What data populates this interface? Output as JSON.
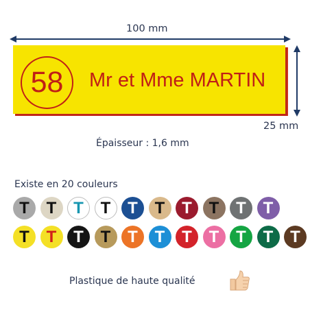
{
  "dimensions": {
    "width_label": "100 mm",
    "height_label": "25 mm",
    "thickness_label": "Épaisseur : 1,6 mm"
  },
  "plate": {
    "number": "58",
    "name": "Mr et Mme MARTIN",
    "background_color": "#f7e400",
    "text_color": "#c01f16"
  },
  "colors": {
    "heading": "Existe en 20 couleurs",
    "row1": [
      {
        "letter": "T",
        "bg": "#a9a9a9",
        "fg": "#111111"
      },
      {
        "letter": "T",
        "bg": "#ddd6c4",
        "fg": "#111111"
      },
      {
        "letter": "T",
        "bg": "#ffffff",
        "fg": "#1796b0"
      },
      {
        "letter": "T",
        "bg": "#ffffff",
        "fg": "#111111"
      },
      {
        "letter": "T",
        "bg": "#1c4f93",
        "fg": "#ffffff"
      },
      {
        "letter": "T",
        "bg": "#d9b98b",
        "fg": "#111111"
      },
      {
        "letter": "T",
        "bg": "#9b1b2e",
        "fg": "#ffffff"
      },
      {
        "letter": "T",
        "bg": "#8c7461",
        "fg": "#111111"
      },
      {
        "letter": "T",
        "bg": "#6f7273",
        "fg": "#ffffff"
      },
      {
        "letter": "T",
        "bg": "#7f5ea8",
        "fg": "#ffffff"
      }
    ],
    "row2": [
      {
        "letter": "T",
        "bg": "#f4e026",
        "fg": "#111111"
      },
      {
        "letter": "T",
        "bg": "#f4e026",
        "fg": "#d1201a"
      },
      {
        "letter": "T",
        "bg": "#151515",
        "fg": "#ffffff"
      },
      {
        "letter": "T",
        "bg": "#b79a5c",
        "fg": "#111111"
      },
      {
        "letter": "T",
        "bg": "#ec7427",
        "fg": "#ffffff"
      },
      {
        "letter": "T",
        "bg": "#1d8fd6",
        "fg": "#ffffff"
      },
      {
        "letter": "T",
        "bg": "#d3232a",
        "fg": "#ffffff"
      },
      {
        "letter": "T",
        "bg": "#ec6fa3",
        "fg": "#ffffff"
      },
      {
        "letter": "T",
        "bg": "#15a543",
        "fg": "#ffffff"
      },
      {
        "letter": "T",
        "bg": "#0d6b47",
        "fg": "#ffffff"
      },
      {
        "letter": "T",
        "bg": "#5c3a22",
        "fg": "#ffffff"
      }
    ]
  },
  "footer": {
    "quality_label": "Plastique de haute qualité",
    "icon": "thumbs-up-icon"
  }
}
